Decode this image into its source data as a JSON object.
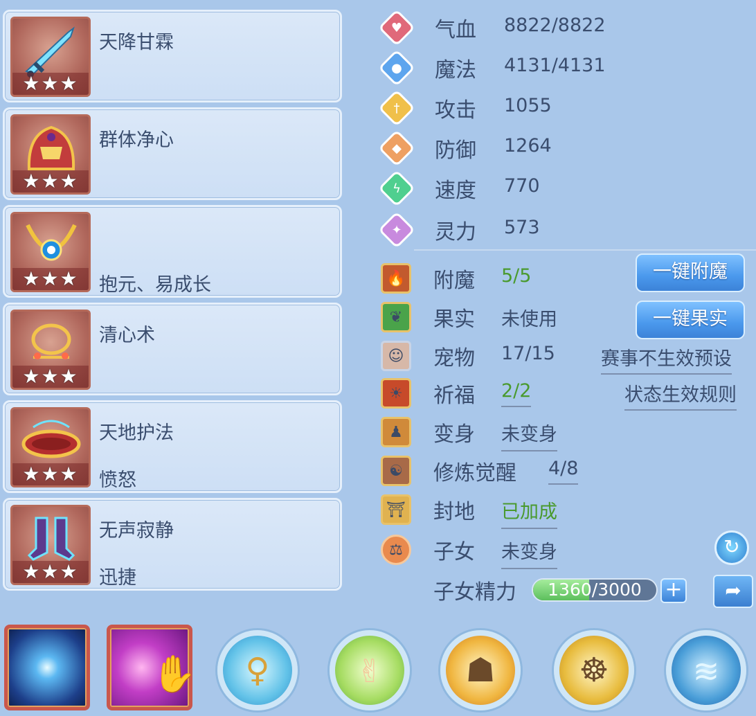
{
  "equipment": [
    {
      "name": "天降甘霖",
      "sub": "",
      "stars": "★★★",
      "icon": "sword-icon"
    },
    {
      "name": "群体净心",
      "sub": "",
      "stars": "★★★",
      "icon": "helmet-icon"
    },
    {
      "name": "",
      "sub": "抱元、易成长",
      "stars": "★★★",
      "icon": "necklace-icon"
    },
    {
      "name": "清心术",
      "sub": "",
      "stars": "★★★",
      "icon": "bracelet-icon"
    },
    {
      "name": "天地护法",
      "sub": "愤怒",
      "stars": "★★★",
      "icon": "belt-icon"
    },
    {
      "name": "无声寂静",
      "sub": "迅捷",
      "stars": "★★★",
      "icon": "boots-icon"
    }
  ],
  "stats": [
    {
      "label": "气血",
      "value": "8822/8822",
      "icon": "heart-icon",
      "color": "#e0697a"
    },
    {
      "label": "魔法",
      "value": "4131/4131",
      "icon": "mana-icon",
      "color": "#5da5ee"
    },
    {
      "label": "攻击",
      "value": "1055",
      "icon": "attack-icon",
      "color": "#f0c04a"
    },
    {
      "label": "防御",
      "value": "1264",
      "icon": "shield-icon",
      "color": "#eea062"
    },
    {
      "label": "速度",
      "value": "770",
      "icon": "speed-icon",
      "color": "#4fcf8f"
    },
    {
      "label": "灵力",
      "value": "573",
      "icon": "spirit-icon",
      "color": "#c88ade"
    }
  ],
  "extras": {
    "enchant": {
      "label": "附魔",
      "value": "5/5"
    },
    "fruit": {
      "label": "果实",
      "value": "未使用"
    },
    "pet": {
      "label": "宠物",
      "value": "17/15"
    },
    "bless": {
      "label": "祈福",
      "value": "2/2"
    },
    "transform": {
      "label": "变身",
      "value": "未变身"
    },
    "awaken": {
      "label": "修炼觉醒",
      "value": "4/8"
    },
    "fief": {
      "label": "封地",
      "value": "已加成"
    },
    "children": {
      "label": "子女",
      "value": "未变身"
    },
    "child_energy": {
      "label": "子女精力",
      "current": "1360",
      "max": "3000",
      "sep": "/",
      "fill": 0.4533
    }
  },
  "buttons": {
    "enchant_all": "一键附魔",
    "fruit_all": "一键果实",
    "preset_link": "赛事不生效预设",
    "rules_link": "状态生效规则"
  },
  "bottom_skills": [
    "star-orb-icon",
    "palm-strike-icon",
    "dancer-icon",
    "hand-sign-icon",
    "monk-icon",
    "meditate-icon",
    "wave-icon"
  ],
  "colors": {
    "accent_green": "#4a9a2e",
    "button_blue": "#4a98ec"
  }
}
